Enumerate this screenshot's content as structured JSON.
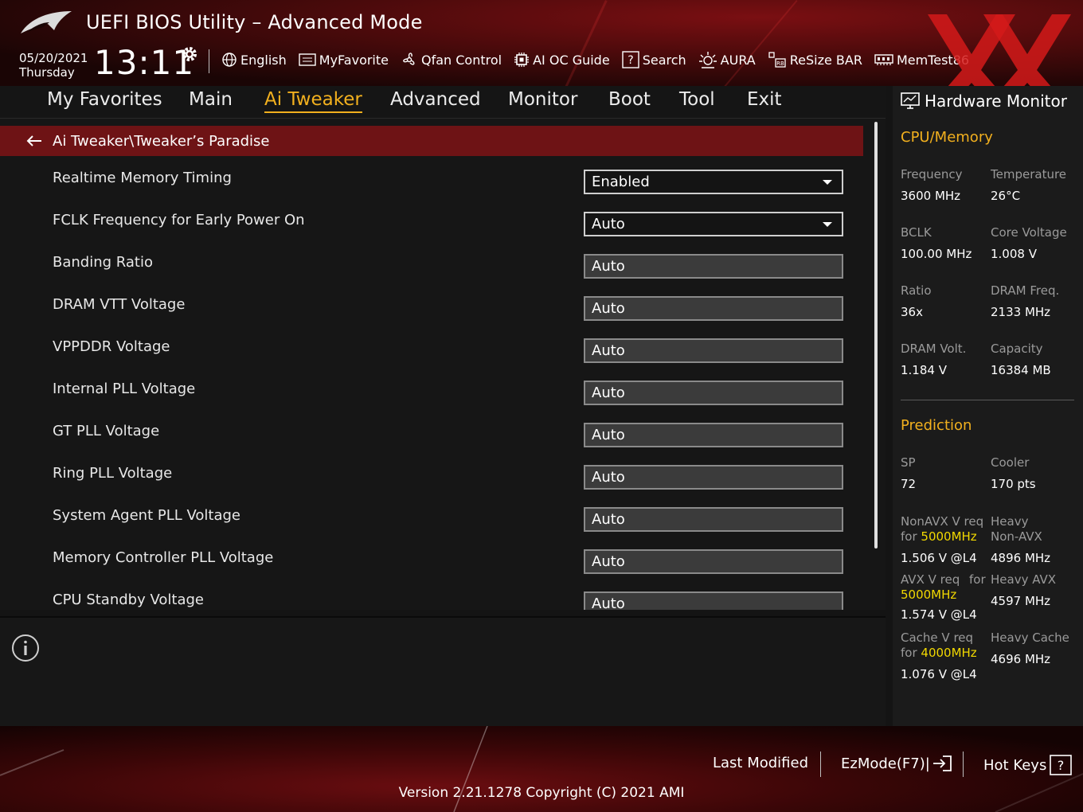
{
  "header": {
    "title": "UEFI BIOS Utility – Advanced Mode",
    "date": "05/20/2021",
    "day": "Thursday",
    "time": "13:11",
    "tools": [
      {
        "label": "English",
        "icon": "globe-icon"
      },
      {
        "label": "MyFavorite",
        "icon": "favorite-list-icon"
      },
      {
        "label": "Qfan Control",
        "icon": "fan-icon"
      },
      {
        "label": "AI OC Guide",
        "icon": "chip-icon"
      },
      {
        "label": "Search",
        "icon": "help-search-icon"
      },
      {
        "label": "AURA",
        "icon": "light-icon"
      },
      {
        "label": "ReSize BAR",
        "icon": "resize-bar-icon"
      },
      {
        "label": "MemTest86",
        "icon": "memory-icon"
      }
    ]
  },
  "tabs": [
    "My Favorites",
    "Main",
    "Ai Tweaker",
    "Advanced",
    "Monitor",
    "Boot",
    "Tool",
    "Exit"
  ],
  "active_tab": "Ai Tweaker",
  "breadcrumb": "Ai Tweaker\\Tweaker’s Paradise",
  "settings": [
    {
      "label": "Realtime Memory Timing",
      "value": "Enabled",
      "type": "select"
    },
    {
      "label": "FCLK Frequency for Early Power On",
      "value": "Auto",
      "type": "select"
    },
    {
      "label": "Banding Ratio",
      "value": "Auto",
      "type": "input"
    },
    {
      "label": "DRAM VTT Voltage",
      "value": "Auto",
      "type": "input"
    },
    {
      "label": "VPPDDR Voltage",
      "value": "Auto",
      "type": "input"
    },
    {
      "label": "Internal PLL Voltage",
      "value": "Auto",
      "type": "input"
    },
    {
      "label": "GT PLL Voltage",
      "value": "Auto",
      "type": "input"
    },
    {
      "label": "Ring PLL Voltage",
      "value": "Auto",
      "type": "input"
    },
    {
      "label": "System Agent PLL Voltage",
      "value": "Auto",
      "type": "input"
    },
    {
      "label": "Memory Controller PLL Voltage",
      "value": "Auto",
      "type": "input"
    },
    {
      "label": "CPU Standby Voltage",
      "value": "Auto",
      "type": "input"
    }
  ],
  "hw_monitor": {
    "title": "Hardware Monitor",
    "cpu_memory": {
      "title": "CPU/Memory",
      "frequency_label": "Frequency",
      "frequency": "3600 MHz",
      "temperature_label": "Temperature",
      "temperature": "26°C",
      "bclk_label": "BCLK",
      "bclk": "100.00 MHz",
      "core_voltage_label": "Core Voltage",
      "core_voltage": "1.008 V",
      "ratio_label": "Ratio",
      "ratio": "36x",
      "dram_freq_label": "DRAM Freq.",
      "dram_freq": "2133 MHz",
      "dram_volt_label": "DRAM Volt.",
      "dram_volt": "1.184 V",
      "capacity_label": "Capacity",
      "capacity": "16384 MB"
    },
    "prediction": {
      "title": "Prediction",
      "sp_label": "SP",
      "sp": "72",
      "cooler_label": "Cooler",
      "cooler": "170 pts",
      "nonavx_label_a": "NonAVX V req",
      "nonavx_label_b": "for ",
      "nonavx_freq": "5000MHz",
      "nonavx_v": "1.506 V @L4",
      "heavy_nonavx_label_a": "Heavy",
      "heavy_nonavx_label_b": "Non-AVX",
      "heavy_nonavx": "4896 MHz",
      "avx_label_a": "AVX V req",
      "avx_label_for": "for",
      "avx_freq": "5000MHz",
      "avx_v": "1.574 V @L4",
      "heavy_avx_label": "Heavy AVX",
      "heavy_avx": "4597 MHz",
      "cache_label_a": "Cache V req",
      "cache_label_b": "for ",
      "cache_freq": "4000MHz",
      "cache_v": "1.076 V @L4",
      "heavy_cache_label": "Heavy Cache",
      "heavy_cache": "4696 MHz"
    }
  },
  "footer": {
    "last_modified": "Last Modified",
    "ezmode": "EzMode(F7)|",
    "hotkeys": "Hot Keys",
    "version": "Version 2.21.1278 Copyright (C) 2021 AMI"
  },
  "colors": {
    "accent": "#f2b01e",
    "highlight": "#f2d800",
    "crumb_bg": "#6e1315"
  }
}
